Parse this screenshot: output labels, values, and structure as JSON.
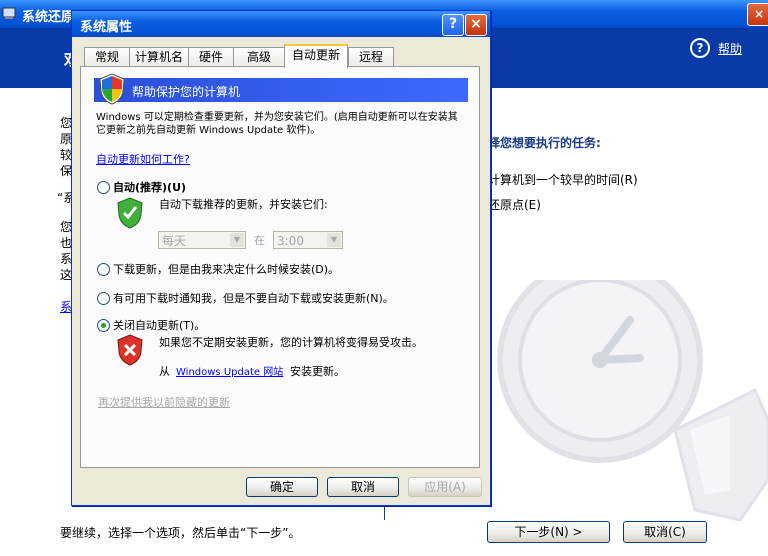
{
  "background_window": {
    "title": "系统还原",
    "close_glyph": "×",
    "help_icon_glyph": "?",
    "help_link": "帮助",
    "header_partial": "欢",
    "left_text_lines": [
      "您",
      "原",
      "较",
      "保",
      "“系",
      "您",
      "也",
      "系",
      "这"
    ],
    "left_link_partial": "系",
    "task_heading_partial": "择您想要执行的任务:",
    "option1_partial": "计算机到一个较早的时间(R)",
    "option2_partial": "还原点(E)",
    "footer_text": "要继续，选择一个选项，然后单击“下一步”。",
    "next_button": "下一步(N) >",
    "cancel_button": "取消(C)"
  },
  "dialog": {
    "title": "系统属性",
    "help_glyph": "?",
    "close_glyph": "×",
    "tabs": [
      {
        "label": "常规",
        "active": false
      },
      {
        "label": "计算机名",
        "active": false
      },
      {
        "label": "硬件",
        "active": false
      },
      {
        "label": "高级",
        "active": false
      },
      {
        "label": "自动更新",
        "active": true
      },
      {
        "label": "远程",
        "active": false
      }
    ],
    "banner_text": "帮助保护您的计算机",
    "description": "Windows 可以定期检查重要更新，并为您安装它们。(启用自动更新可以在安装其它更新之前先自动更新 Windows Update 软件)。",
    "how_it_works_link": "自动更新如何工作?",
    "options": {
      "auto_label": "自动(推荐)(U)",
      "auto_desc": "自动下载推荐的更新，并安装它们:",
      "day_value": "每天",
      "at_label": "在",
      "time_value": "3:00",
      "download_label": "下载更新，但是由我来决定什么时候安装(D)。",
      "notify_label": "有可用下载时通知我，但是不要自动下载或安装更新(N)。",
      "off_label": "关闭自动更新(T)。",
      "off_desc": "如果您不定期安装更新，您的计算机将变得易受攻击。",
      "from_label": "从",
      "wu_link": "Windows Update 网站",
      "install_suffix": "安装更新。",
      "selected": "off"
    },
    "reoffer_link": "再次提供我以前隐藏的更新",
    "buttons": {
      "ok": "确定",
      "cancel": "取消",
      "apply": "应用(A)"
    }
  },
  "colors": {
    "title_blue": "#0453d6",
    "dialog_bg": "#ece9d8",
    "link": "#0000ff",
    "disabled": "#a7a6aa"
  }
}
